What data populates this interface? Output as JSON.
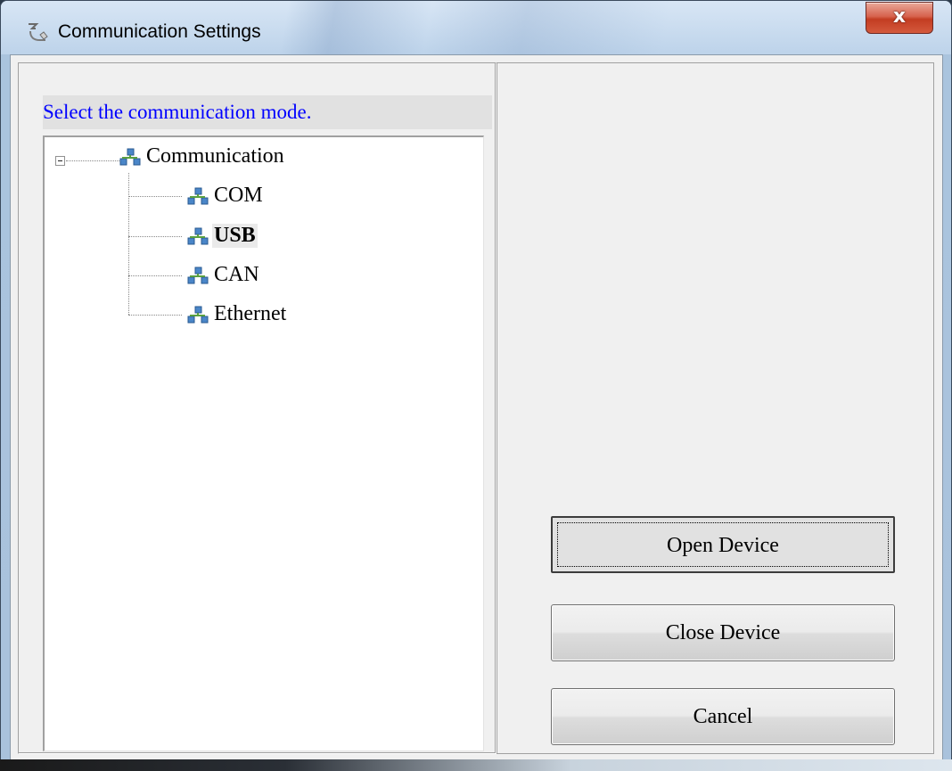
{
  "window": {
    "title": "Communication Settings",
    "close_label": "x",
    "icon": "communication-app-icon"
  },
  "left": {
    "instruction": "Select the communication mode.",
    "instruction_color": "#0000ff",
    "tree": {
      "root": {
        "label": "Communication",
        "icon": "network-icon",
        "expanded": true
      },
      "children": [
        {
          "label": "COM",
          "icon": "network-icon",
          "selected": false
        },
        {
          "label": "USB",
          "icon": "network-icon",
          "selected": true
        },
        {
          "label": "CAN",
          "icon": "network-icon",
          "selected": false
        },
        {
          "label": "Ethernet",
          "icon": "network-icon",
          "selected": false
        }
      ]
    }
  },
  "buttons": {
    "open": "Open Device",
    "close": "Close Device",
    "cancel": "Cancel"
  }
}
